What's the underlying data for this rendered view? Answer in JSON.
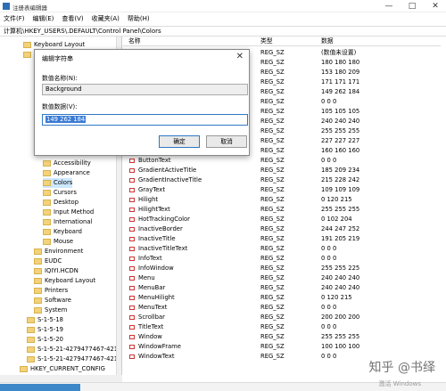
{
  "window": {
    "title": "注册表编辑器",
    "buttons": [
      "—",
      "□",
      "✕"
    ]
  },
  "menu": [
    "文件(F)",
    "编辑(E)",
    "查看(V)",
    "收藏夹(A)",
    "帮助(H)"
  ],
  "address": "计算机\\HKEY_USERS\\.DEFAULT\\Control Panel\\Colors",
  "tree": {
    "items": [
      {
        "label": "Keyboard Layout",
        "indent": 26
      },
      {
        "label": "Printers",
        "indent": 26
      },
      {
        "label": "Accessibility",
        "indent": 48
      },
      {
        "label": "Appearance",
        "indent": 48
      },
      {
        "label": "Colors",
        "indent": 48,
        "selected": true
      },
      {
        "label": "Cursors",
        "indent": 48
      },
      {
        "label": "Desktop",
        "indent": 48
      },
      {
        "label": "Input Method",
        "indent": 48
      },
      {
        "label": "International",
        "indent": 48
      },
      {
        "label": "Keyboard",
        "indent": 48
      },
      {
        "label": "Mouse",
        "indent": 48
      },
      {
        "label": "Environment",
        "indent": 38
      },
      {
        "label": "EUDC",
        "indent": 38
      },
      {
        "label": "IQIYI.HCDN",
        "indent": 38
      },
      {
        "label": "Keyboard Layout",
        "indent": 38
      },
      {
        "label": "Printers",
        "indent": 38
      },
      {
        "label": "Software",
        "indent": 38
      },
      {
        "label": "System",
        "indent": 38
      },
      {
        "label": "S-1-5-18",
        "indent": 30
      },
      {
        "label": "S-1-5-19",
        "indent": 30
      },
      {
        "label": "S-1-5-20",
        "indent": 30
      },
      {
        "label": "S-1-5-21-4279477467-421",
        "indent": 30
      },
      {
        "label": "S-1-5-21-4279477467-421",
        "indent": 30
      },
      {
        "label": "HKEY_CURRENT_CONFIG",
        "indent": 22
      }
    ]
  },
  "list": {
    "headers": [
      "名称",
      "类型",
      "数据"
    ],
    "rows": [
      {
        "name": "",
        "type": "REG_SZ",
        "data": "(数值未设置)"
      },
      {
        "name": "",
        "type": "REG_SZ",
        "data": "180 180 180"
      },
      {
        "name": "",
        "type": "REG_SZ",
        "data": "153 180 209"
      },
      {
        "name": "",
        "type": "REG_SZ",
        "data": "171 171 171"
      },
      {
        "name": "",
        "type": "REG_SZ",
        "data": "149 262 184"
      },
      {
        "name": "",
        "type": "REG_SZ",
        "data": "0 0 0"
      },
      {
        "name": "",
        "type": "REG_SZ",
        "data": "105 105 105"
      },
      {
        "name": "",
        "type": "REG_SZ",
        "data": "240 240 240"
      },
      {
        "name": "",
        "type": "REG_SZ",
        "data": "255 255 255"
      },
      {
        "name": "",
        "type": "REG_SZ",
        "data": "227 227 227"
      },
      {
        "name": "ButtonShadow",
        "type": "REG_SZ",
        "data": "160 160 160"
      },
      {
        "name": "ButtonText",
        "type": "REG_SZ",
        "data": "0 0 0"
      },
      {
        "name": "GradientActiveTitle",
        "type": "REG_SZ",
        "data": "185 209 234"
      },
      {
        "name": "GradientInactiveTitle",
        "type": "REG_SZ",
        "data": "215 228 242"
      },
      {
        "name": "GrayText",
        "type": "REG_SZ",
        "data": "109 109 109"
      },
      {
        "name": "Hilight",
        "type": "REG_SZ",
        "data": "0 120 215"
      },
      {
        "name": "HilightText",
        "type": "REG_SZ",
        "data": "255 255 255"
      },
      {
        "name": "HotTrackingColor",
        "type": "REG_SZ",
        "data": "0 102 204"
      },
      {
        "name": "InactiveBorder",
        "type": "REG_SZ",
        "data": "244 247 252"
      },
      {
        "name": "InactiveTitle",
        "type": "REG_SZ",
        "data": "191 205 219"
      },
      {
        "name": "InactiveTitleText",
        "type": "REG_SZ",
        "data": "0 0 0"
      },
      {
        "name": "InfoText",
        "type": "REG_SZ",
        "data": "0 0 0"
      },
      {
        "name": "InfoWindow",
        "type": "REG_SZ",
        "data": "255 255 225"
      },
      {
        "name": "Menu",
        "type": "REG_SZ",
        "data": "240 240 240"
      },
      {
        "name": "MenuBar",
        "type": "REG_SZ",
        "data": "240 240 240"
      },
      {
        "name": "MenuHilight",
        "type": "REG_SZ",
        "data": "0 120 215"
      },
      {
        "name": "MenuText",
        "type": "REG_SZ",
        "data": "0 0 0"
      },
      {
        "name": "Scrollbar",
        "type": "REG_SZ",
        "data": "200 200 200"
      },
      {
        "name": "TitleText",
        "type": "REG_SZ",
        "data": "0 0 0"
      },
      {
        "name": "Window",
        "type": "REG_SZ",
        "data": "255 255 255"
      },
      {
        "name": "WindowFrame",
        "type": "REG_SZ",
        "data": "100 100 100"
      },
      {
        "name": "WindowText",
        "type": "REG_SZ",
        "data": "0 0 0"
      }
    ]
  },
  "dialog": {
    "title": "编辑字符串",
    "close": "✕",
    "name_label": "数值名称(N):",
    "name_value": "Background",
    "data_label": "数值数据(V):",
    "data_value": "149 262 184",
    "ok": "确定",
    "cancel": "取消"
  },
  "watermark": "知乎 @书绎",
  "watermark2": "激活 Windows"
}
